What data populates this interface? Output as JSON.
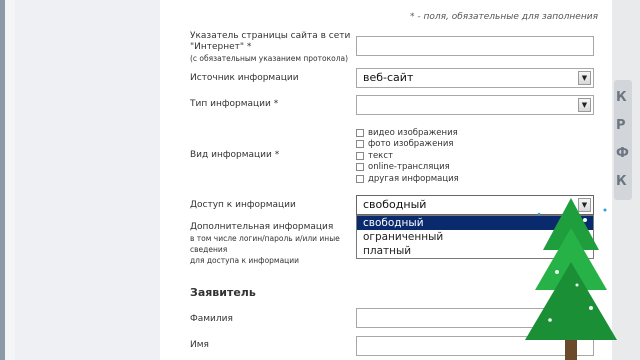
{
  "note": "* - поля, обязательные для заполнения",
  "fields": {
    "url": {
      "label_line1": "Указатель страницы сайта в сети",
      "label_line2": "\"Интернет\" *",
      "label_hint": "(с обязательным указанием протокола)",
      "value": ""
    },
    "source": {
      "label": "Источник информации",
      "value": "веб-сайт"
    },
    "type": {
      "label": "Тип информации *",
      "value": ""
    },
    "kind": {
      "label": "Вид информации *",
      "options": [
        "видео изображения",
        "фото изображения",
        "текст",
        "online-трансляция",
        "другая информация"
      ]
    },
    "access": {
      "label": "Доступ к информации",
      "value": "свободный",
      "options": [
        "свободный",
        "ограниченный",
        "платный"
      ]
    },
    "extra": {
      "label": "Дополнительная информация",
      "hint_line1": "в том числе логин/пароль и/или иные",
      "hint_line2": "сведения",
      "hint_line3": "для доступа к информации"
    }
  },
  "applicant": {
    "title": "Заявитель",
    "surname_label": "Фамилия",
    "name_label": "Имя"
  },
  "sidebar_tab_letters": [
    "К",
    "Р",
    "Ф",
    "К"
  ],
  "colors": {
    "highlight": "#0a2a6e",
    "tree": "#1e9e3c"
  }
}
